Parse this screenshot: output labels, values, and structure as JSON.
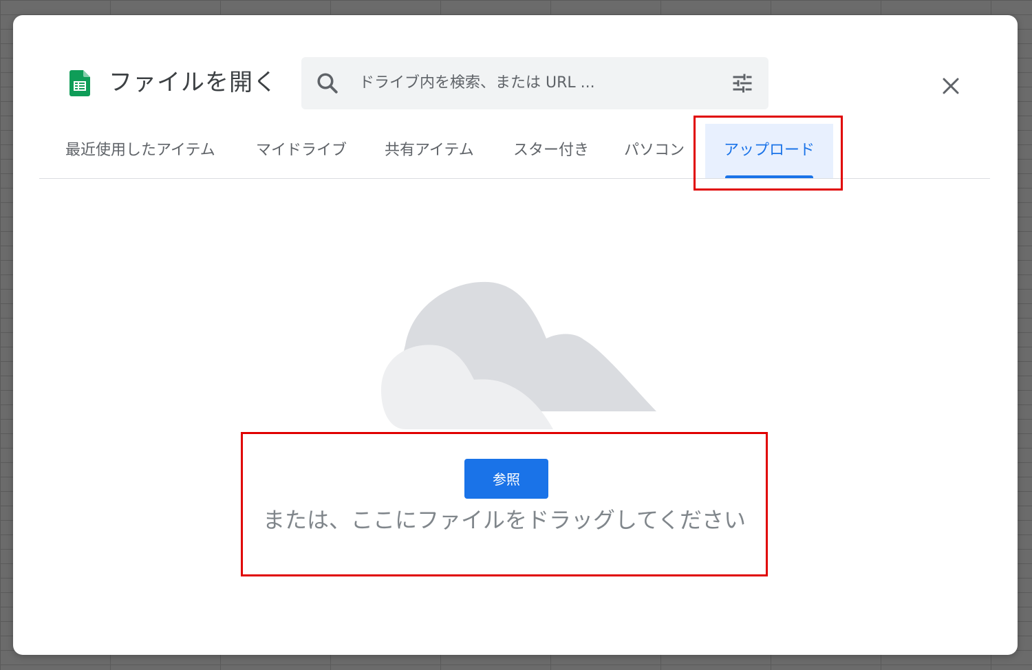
{
  "dialog": {
    "title": "ファイルを開く",
    "app_icon": "google-sheets-icon"
  },
  "search": {
    "placeholder": "ドライブ内を検索、または URL ...",
    "icon": "search-icon",
    "options_icon": "tune-icon"
  },
  "close_icon": "close-icon",
  "tabs": [
    {
      "label": "最近使用したアイテム",
      "active": false
    },
    {
      "label": "マイドライブ",
      "active": false
    },
    {
      "label": "共有アイテム",
      "active": false
    },
    {
      "label": "スター付き",
      "active": false
    },
    {
      "label": "パソコン",
      "active": false
    },
    {
      "label": "アップロード",
      "active": true
    }
  ],
  "upload": {
    "illustration": "cloud-illustration",
    "browse_label": "参照",
    "drag_text": "または、ここにファイルをドラッグしてください"
  },
  "colors": {
    "accent": "#1a73e8",
    "active_tab_bg": "#e8f0fe",
    "highlight": "#e00000",
    "sheets_green": "#0f9d58"
  }
}
